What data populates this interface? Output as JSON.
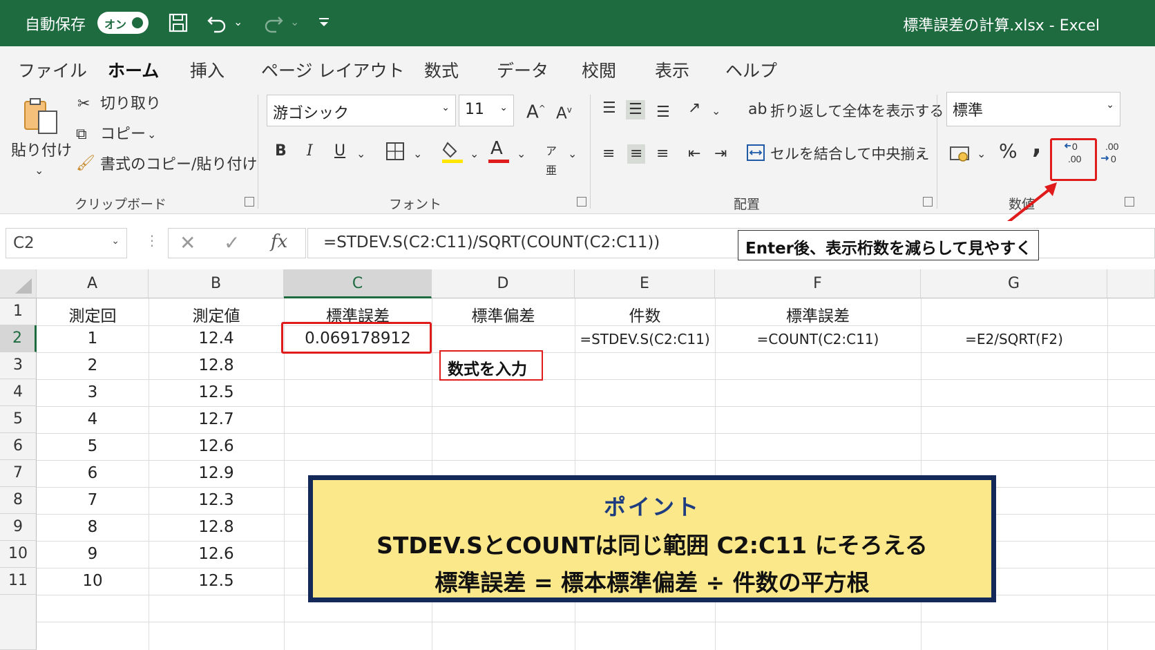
{
  "titlebar": {
    "autosave_label": "自動保存",
    "autosave_state": "オン",
    "title": "標準誤差の計算.xlsx  -  Excel",
    "bg_color": "#1e6b40"
  },
  "tabs": [
    {
      "label": "ファイル"
    },
    {
      "label": "ホーム"
    },
    {
      "label": "挿入"
    },
    {
      "label": "ページ レイアウト"
    },
    {
      "label": "数式"
    },
    {
      "label": "データ"
    },
    {
      "label": "校閲"
    },
    {
      "label": "表示"
    },
    {
      "label": "ヘルプ"
    }
  ],
  "ribbon": {
    "clipboard": {
      "paste_label": "貼り付け",
      "cut_label": "切り取り",
      "copy_label": "コピー",
      "format_painter_label": "書式のコピー/貼り付け",
      "group_label": "クリップボード"
    },
    "font": {
      "font_name": "游ゴシック",
      "font_size": "11",
      "bold": "B",
      "italic": "I",
      "underline": "U",
      "font_color_letter": "A",
      "group_label": "フォント"
    },
    "alignment": {
      "wrap_label": "折り返して全体を表示する",
      "merge_label": "セルを結合して中央揃え",
      "group_label": "配置"
    },
    "number": {
      "format_value": "標準",
      "percent": "%",
      "comma": ",",
      "group_label": "数値"
    }
  },
  "formula_bar": {
    "name_box": "C2",
    "fx": "fx",
    "formula": "=STDEV.S(C2:C11)/SQRT(COUNT(C2:C11))",
    "callout": "Enter後、表示桁数を減らして見やすく"
  },
  "columns": [
    "A",
    "B",
    "C",
    "D",
    "E",
    "F",
    "G"
  ],
  "rows": [
    "1",
    "2",
    "3",
    "4",
    "5",
    "6",
    "7",
    "8",
    "9",
    "10",
    "11"
  ],
  "sheet": {
    "header_row": [
      "測定回",
      "測定値",
      "標準誤差",
      "標準偏差",
      "件数",
      "標準誤差",
      ""
    ],
    "data": [
      {
        "a": "1",
        "b": "12.4"
      },
      {
        "a": "2",
        "b": "12.8"
      },
      {
        "a": "3",
        "b": "12.5"
      },
      {
        "a": "4",
        "b": "12.7"
      },
      {
        "a": "5",
        "b": "12.6"
      },
      {
        "a": "6",
        "b": "12.9"
      },
      {
        "a": "7",
        "b": "12.3"
      },
      {
        "a": "8",
        "b": "12.8"
      },
      {
        "a": "9",
        "b": "12.6"
      },
      {
        "a": "10",
        "b": "12.5"
      }
    ],
    "c2": "0.069178912",
    "e2": "=STDEV.S(C2:C11)",
    "f2": "=COUNT(C2:C11)",
    "g2": "=E2/SQRT(F2)",
    "note": "数式を入力"
  },
  "point_box": {
    "title": "ポイント",
    "line1": "STDEV.SとCOUNTは同じ範囲 C2:C11 にそろえる",
    "line2": "標準誤差 = 標本標準偏差 ÷ 件数の平方根"
  },
  "colors": {
    "highlight": "#e01b1b",
    "point_bg": "#fbe88a",
    "point_border": "#14295a"
  }
}
